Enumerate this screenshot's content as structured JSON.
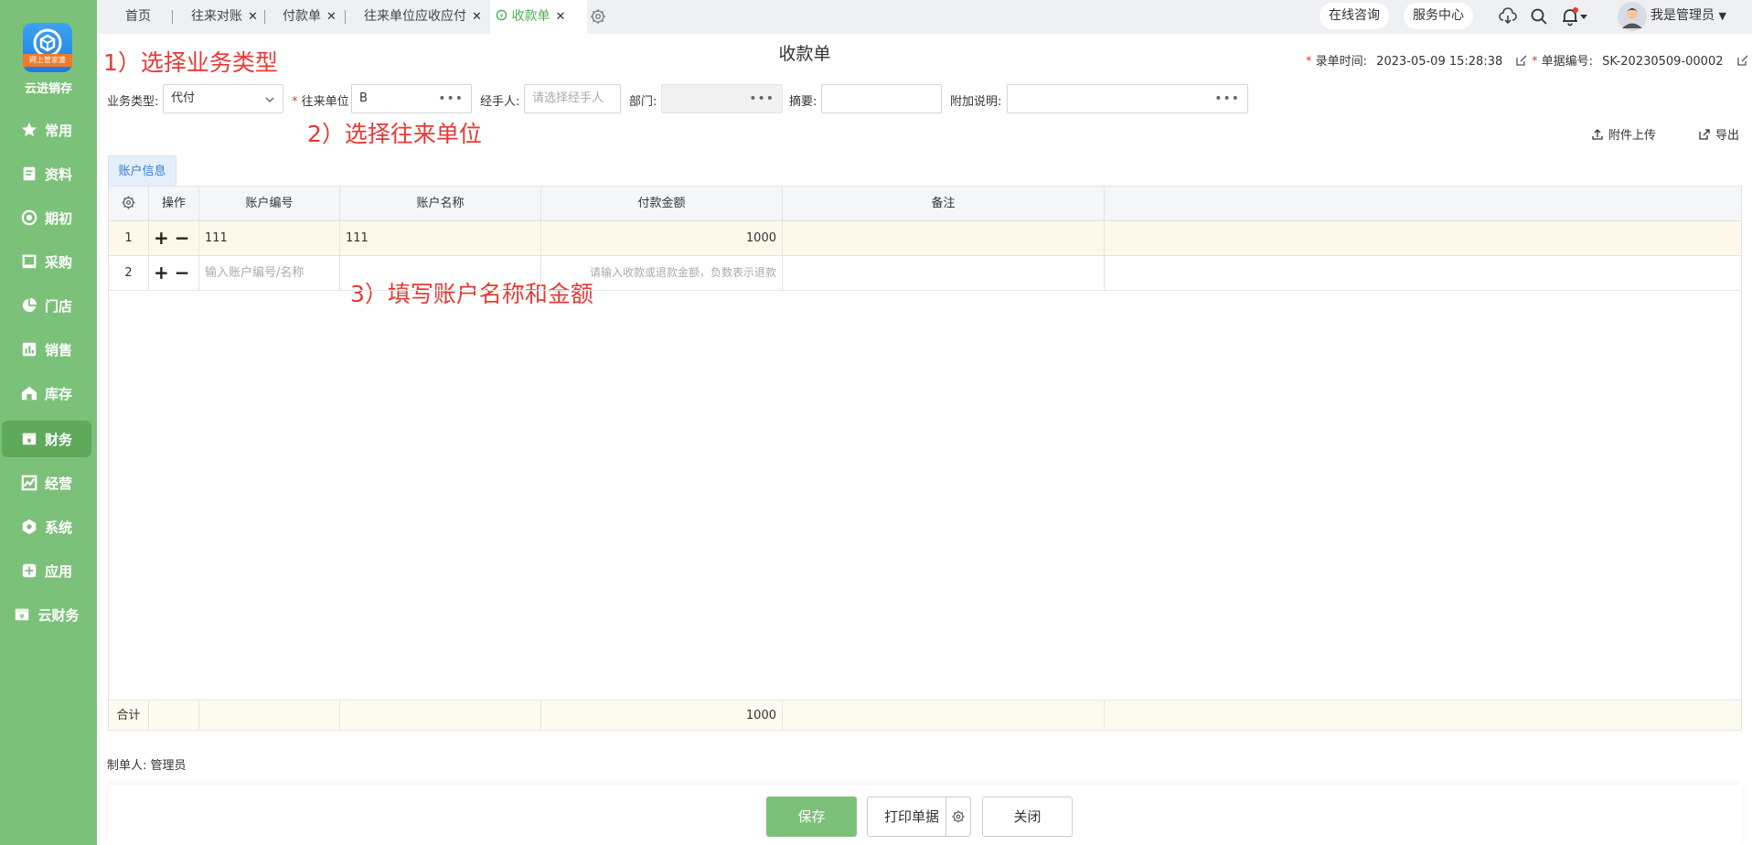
{
  "brand": {
    "name": "云进销存",
    "logo_ribbon": "网上管家婆"
  },
  "nav": [
    {
      "label": "常用",
      "icon": "star-icon"
    },
    {
      "label": "资料",
      "icon": "document-icon"
    },
    {
      "label": "期初",
      "icon": "target-icon"
    },
    {
      "label": "采购",
      "icon": "purchase-icon"
    },
    {
      "label": "门店",
      "icon": "pie-icon"
    },
    {
      "label": "销售",
      "icon": "bar-chart-icon"
    },
    {
      "label": "库存",
      "icon": "warehouse-icon"
    },
    {
      "label": "财务",
      "icon": "finance-icon",
      "active": true
    },
    {
      "label": "经营",
      "icon": "trend-icon"
    },
    {
      "label": "系统",
      "icon": "hexagon-gear-icon"
    },
    {
      "label": "应用",
      "icon": "plus-box-icon"
    },
    {
      "label": "云财务",
      "icon": "cloud-finance-icon"
    }
  ],
  "tabs": [
    {
      "label": "首页",
      "closable": false
    },
    {
      "label": "往来对账",
      "closable": true
    },
    {
      "label": "付款单",
      "closable": true
    },
    {
      "label": "往来单位应收应付",
      "closable": true
    },
    {
      "label": "收款单",
      "closable": true,
      "active": true
    }
  ],
  "topbar": {
    "consult": "在线咨询",
    "service": "服务中心",
    "user": "我是管理员"
  },
  "form": {
    "title": "收款单",
    "record_time_label": "录单时间:",
    "record_time": "2023-05-09 15:28:38",
    "doc_no_label": "单据编号:",
    "doc_no": "SK-20230509-00002",
    "biz_type_label": "业务类型:",
    "biz_type": "代付",
    "partner_label": "往来单位",
    "partner": "B",
    "handler_label": "经手人:",
    "handler_placeholder": "请选择经手人",
    "dept_label": "部门:",
    "summary_label": "摘要:",
    "summary": "",
    "extra_label": "附加说明:",
    "extra": "",
    "attach": "附件上传",
    "export": "导出",
    "subtab": "账户信息"
  },
  "hints": {
    "step1": "1）选择业务类型",
    "step2": "2）选择往来单位",
    "step3": "3）填写账户名称和金额"
  },
  "table": {
    "headers": [
      "操作",
      "账户编号",
      "账户名称",
      "付款金额",
      "备注"
    ],
    "rows": [
      {
        "no": "1",
        "code": "111",
        "name": "111",
        "amount": "1000",
        "note": ""
      },
      {
        "no": "2",
        "code_placeholder": "输入账户编号/名称",
        "name": "",
        "amount_placeholder": "请输入收款或退款金额，负数表示退款",
        "note": ""
      }
    ],
    "sum_label": "合计",
    "sum_amount": "1000"
  },
  "maker_label": "制单人:",
  "maker": "管理员",
  "buttons": {
    "save": "保存",
    "print": "打印单据",
    "close": "关闭"
  },
  "colors": {
    "sidebar": "#7cc17a",
    "active_tab": "#4caf50",
    "hint": "#e53935",
    "save": "#7cc17a"
  }
}
